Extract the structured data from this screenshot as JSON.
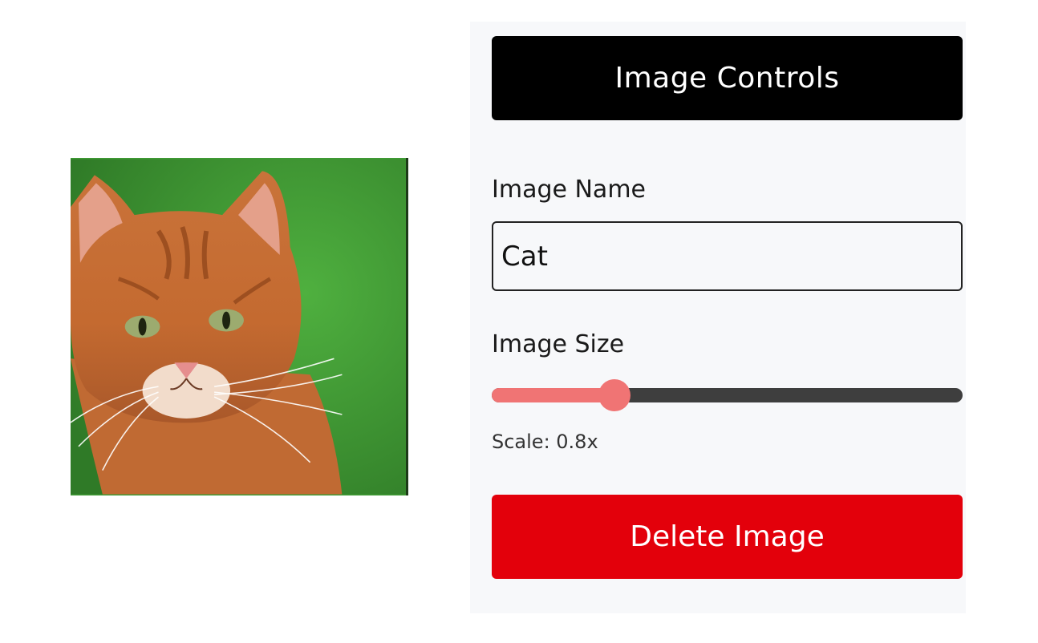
{
  "image": {
    "subject": "orange tabby cat portrait on green background"
  },
  "panel": {
    "title": "Image Controls",
    "name_label": "Image Name",
    "name_value": "Cat",
    "size_label": "Image Size",
    "slider_fraction": 0.26,
    "scale_text": "Scale: 0.8x",
    "delete_label": "Delete Image"
  },
  "colors": {
    "header_bg": "#000000",
    "delete_bg": "#e3000b",
    "slider_accent": "#f07474",
    "slider_track": "#3e3e3e",
    "panel_bg": "#f7f8fa"
  }
}
